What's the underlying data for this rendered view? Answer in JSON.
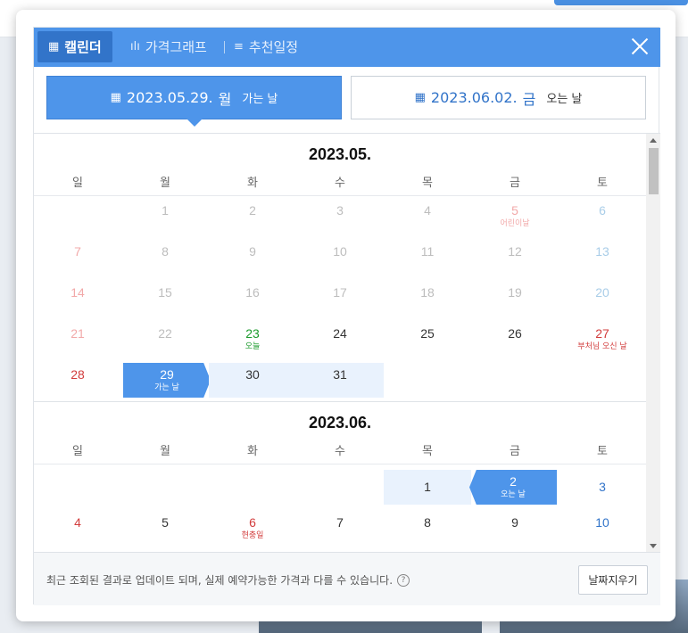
{
  "tabs": {
    "calendar": "캘린더",
    "price_graph": "가격그래프",
    "recommended": "추천일정"
  },
  "go_date": {
    "date": "2023.05.29.",
    "dow": "월",
    "label": "가는 날"
  },
  "return_date": {
    "date": "2023.06.02.",
    "dow": "금",
    "label": "오는 날"
  },
  "weekdays": [
    "일",
    "월",
    "화",
    "수",
    "목",
    "금",
    "토"
  ],
  "may": {
    "title": "2023.05.",
    "holiday_5": "어린이날",
    "today_label": "오늘",
    "holiday_27": "부처님 오신 날",
    "go_label": "가는 날"
  },
  "june": {
    "title": "2023.06.",
    "return_label": "오는 날",
    "holiday_6": "현충일"
  },
  "footer": {
    "note": "최근 조회된 결과로 업데이트 되며, 실제 예약가능한 가격과 다를 수 있습니다.",
    "help": "?",
    "clear": "날짜지우기"
  },
  "colors": {
    "accent": "#4e95ea",
    "sunday": "#d23c3c",
    "saturday": "#3274c9",
    "today": "#1a9a2b"
  }
}
